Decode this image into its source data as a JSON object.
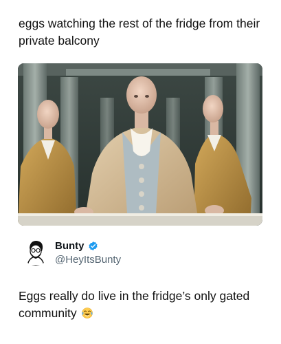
{
  "post": {
    "caption": "eggs watching the rest of the fridge from their private balcony"
  },
  "image": {
    "icon": "balcony-photo"
  },
  "tweet": {
    "author_name": "Bunty",
    "author_handle": "@HeyItsBunty",
    "verified_icon": "verified-badge-icon",
    "text": "Eggs really do live in the fridge’s only gated community",
    "emoji_icon": "tears-of-joy-emoji-icon"
  },
  "colors": {
    "verified": "#1d9bf0",
    "handle": "#536471",
    "text": "#111111"
  }
}
